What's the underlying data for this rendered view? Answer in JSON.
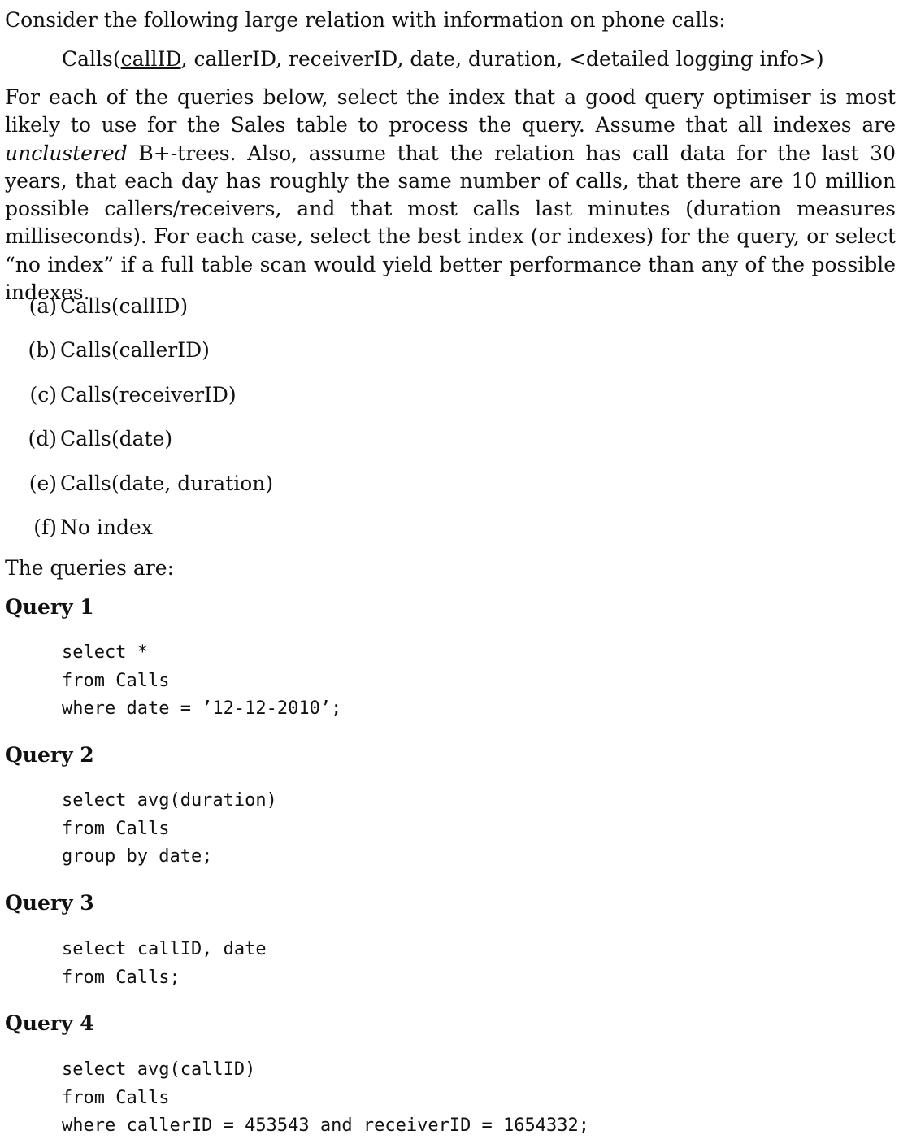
{
  "intro": "Consider the following large relation with information on phone calls:",
  "schema": {
    "prefix": "Calls(",
    "key": "callID",
    "rest": ", callerID, receiverID, date, duration, <detailed logging info>)"
  },
  "instructions": {
    "part1": "For each of the queries below, select the index that a good query optimiser is most likely to use for the Sales table to process the query. Assume that all indexes are ",
    "emphasis": "unclustered",
    "part2": " B+-trees. Also, assume that the relation has call data for the last 30 years, that each day has roughly the same number of calls, that there are 10 million possible callers/receivers, and that most calls last minutes (duration measures milliseconds). For each case, select the best index (or indexes) for the query, or select “no index” if a full table scan would yield better performance than any of the possible indexes."
  },
  "options": [
    {
      "letter": "(a)",
      "text": "Calls(callID)"
    },
    {
      "letter": "(b)",
      "text": "Calls(callerID)"
    },
    {
      "letter": "(c)",
      "text": "Calls(receiverID)"
    },
    {
      "letter": "(d)",
      "text": "Calls(date)"
    },
    {
      "letter": "(e)",
      "text": "Calls(date, duration)"
    },
    {
      "letter": "(f)",
      "text": "No index"
    }
  ],
  "queries_intro": "The queries are:",
  "queries": [
    {
      "title": "Query 1",
      "code": "select *\nfrom Calls\nwhere date = ’12-12-2010’;"
    },
    {
      "title": "Query 2",
      "code": "select avg(duration)\nfrom Calls\ngroup by date;"
    },
    {
      "title": "Query 3",
      "code": "select callID, date\nfrom Calls;"
    },
    {
      "title": "Query 4",
      "code": "select avg(callID)\nfrom Calls\nwhere callerID = 453543 and receiverID = 1654332;"
    }
  ]
}
